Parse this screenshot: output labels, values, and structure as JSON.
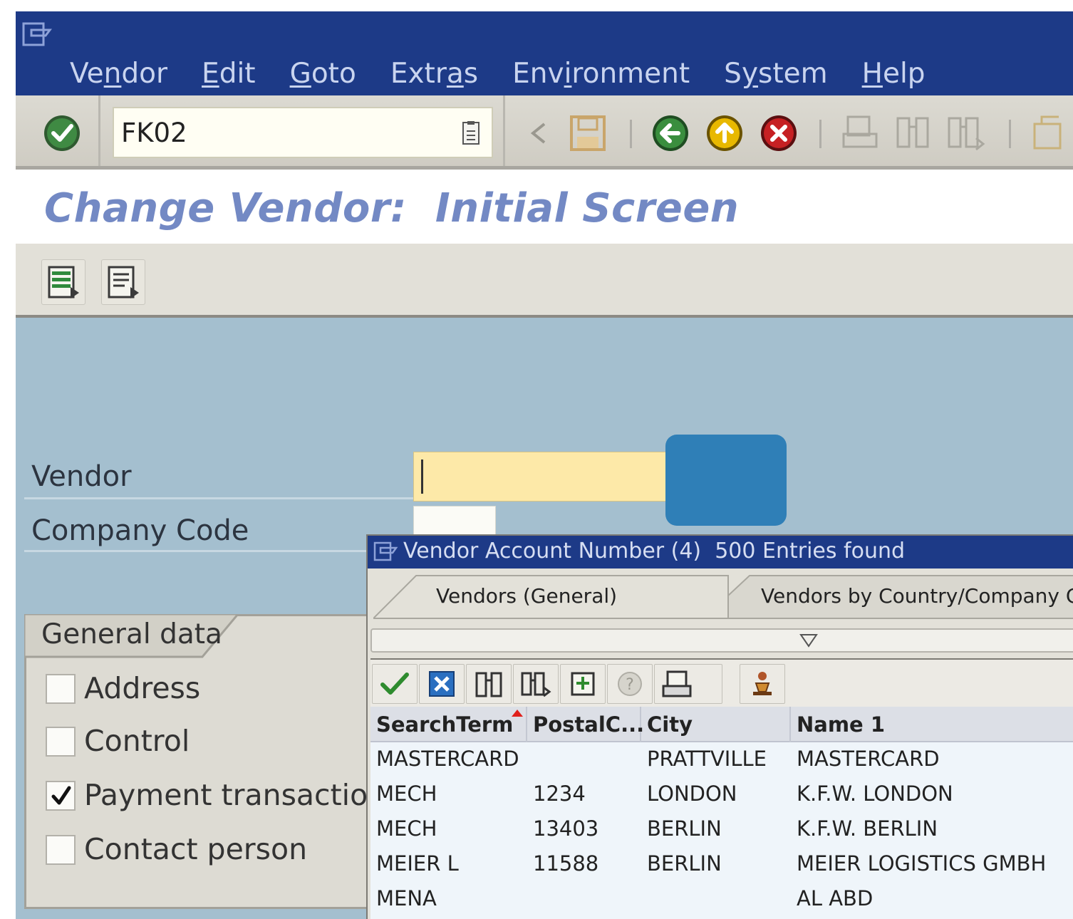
{
  "menu": {
    "items": [
      {
        "pre": "Ve",
        "u": "n",
        "post": "dor"
      },
      {
        "pre": "",
        "u": "E",
        "post": "dit"
      },
      {
        "pre": "",
        "u": "G",
        "post": "oto"
      },
      {
        "pre": "Extr",
        "u": "a",
        "post": "s"
      },
      {
        "pre": "Env",
        "u": "i",
        "post": "ronment"
      },
      {
        "pre": "S",
        "u": "y",
        "post": "stem"
      },
      {
        "pre": "",
        "u": "H",
        "post": "elp"
      }
    ]
  },
  "toolbar": {
    "command_value": "FK02",
    "icons": [
      "enter-icon",
      "command-dropdown-icon",
      "previous-icon",
      "save-icon",
      "back-icon",
      "exit-icon",
      "cancel-icon",
      "print-icon",
      "find-icon",
      "find-next-icon",
      "new-session-icon"
    ]
  },
  "screen": {
    "title": "Change Vendor:  Initial Screen"
  },
  "fields": {
    "vendor_label": "Vendor",
    "vendor_value": "",
    "company_code_label": "Company Code",
    "company_code_value": ""
  },
  "general_data": {
    "title": "General data",
    "checkboxes": [
      {
        "label": "Address",
        "checked": false
      },
      {
        "label": "Control",
        "checked": false
      },
      {
        "label": "Payment transactions",
        "checked": true
      },
      {
        "label": "Contact person",
        "checked": false
      }
    ]
  },
  "popup": {
    "title": "Vendor Account Number (4)  500 Entries found",
    "tabs": [
      "Vendors (General)",
      "Vendors by Country/Company Code"
    ],
    "columns": [
      "SearchTerm",
      "PostalC...",
      "City",
      "Name 1"
    ],
    "rows": [
      [
        "MASTERCARD",
        "",
        "PRATTVILLE",
        "MASTERCARD"
      ],
      [
        "MECH",
        "1234",
        "LONDON",
        "K.F.W. LONDON"
      ],
      [
        "MECH",
        "13403",
        "BERLIN",
        "K.F.W. BERLIN"
      ],
      [
        "MEIER L",
        "11588",
        "BERLIN",
        "MEIER LOGISTICS GMBH"
      ],
      [
        "MENA",
        "",
        "",
        "AL ABD"
      ]
    ]
  },
  "colors": {
    "menubar": "#1d3a87",
    "workarea": "#a4bfcf",
    "title_text": "#7389c4",
    "input_focus": "#fde9a8"
  }
}
